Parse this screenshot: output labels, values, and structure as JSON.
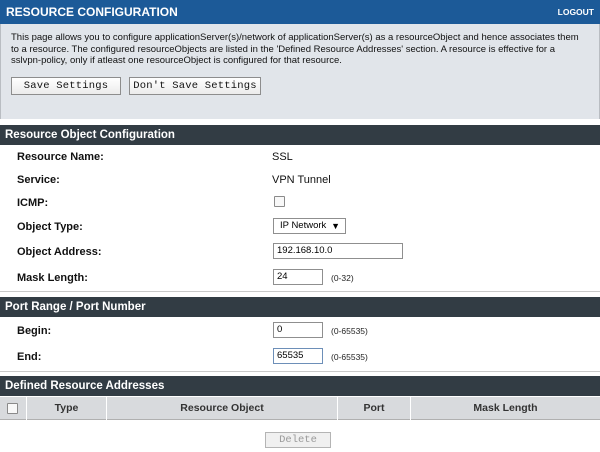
{
  "header": {
    "title": "RESOURCE CONFIGURATION",
    "logout_label": "LOGOUT"
  },
  "intro": {
    "text": "This page allows you to configure applicationServer(s)/network of applicationServer(s) as a resourceObject and hence associates them to a resource. The configured resourceObjects are listed in the 'Defined Resource Addresses' section. A resource is effective for a sslvpn-policy, only if atleast one resourceObject is configured for that resource.",
    "save_label": "Save Settings",
    "dont_save_label": "Don't Save Settings"
  },
  "resource_object": {
    "section_title": "Resource Object Configuration",
    "resource_name_label": "Resource Name:",
    "resource_name_value": "SSL",
    "service_label": "Service:",
    "service_value": "VPN Tunnel",
    "icmp_label": "ICMP:",
    "icmp_checked": false,
    "object_type_label": "Object Type:",
    "object_type_value": "IP Network",
    "object_address_label": "Object Address:",
    "object_address_value": "192.168.10.0",
    "mask_length_label": "Mask Length:",
    "mask_length_value": "24",
    "mask_length_hint": "(0-32)"
  },
  "port_range": {
    "section_title": "Port Range / Port Number",
    "begin_label": "Begin:",
    "begin_value": "0",
    "begin_hint": "(0-65535)",
    "end_label": "End:",
    "end_value": "65535",
    "end_hint": "(0-65535)"
  },
  "defined_addresses": {
    "section_title": "Defined Resource Addresses",
    "columns": [
      "Type",
      "Resource Object",
      "Port",
      "Mask Length"
    ],
    "delete_label": "Delete"
  },
  "colors": {
    "header_bar": "#1c5a98",
    "section_header": "#323c44",
    "info_panel": "#e1e5ea"
  }
}
